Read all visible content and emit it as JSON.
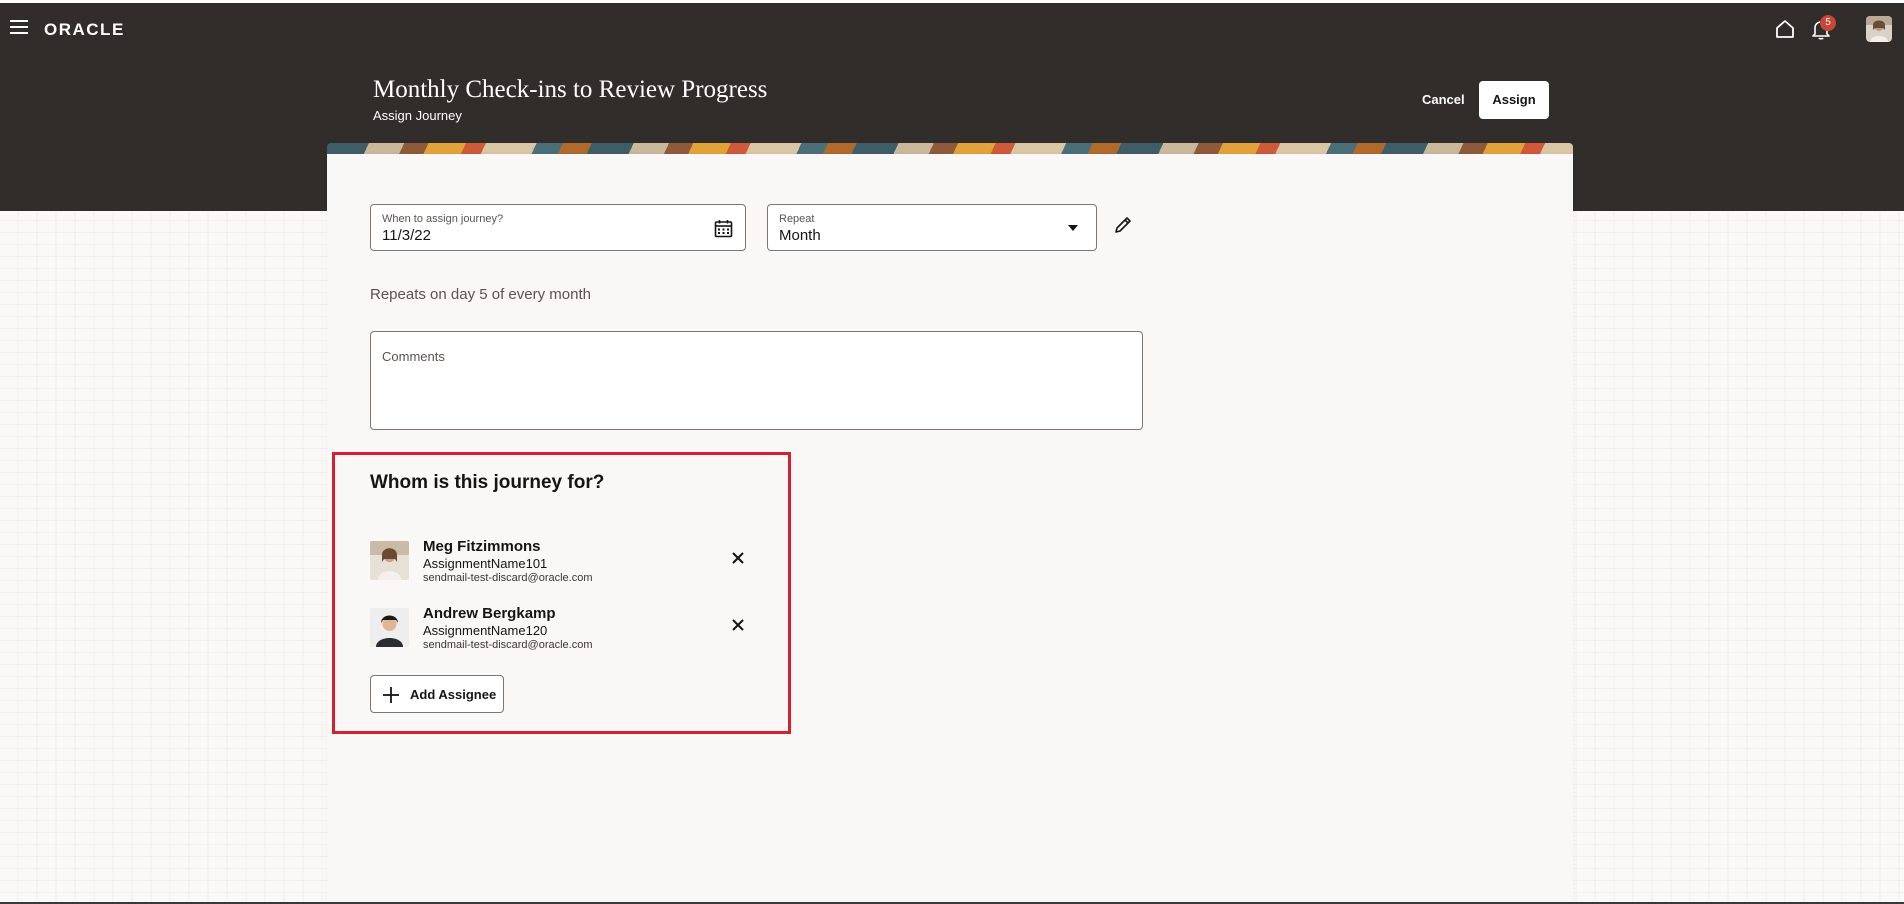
{
  "app": {
    "brand": "ORACLE",
    "notification_count": "5",
    "icons": {
      "menu": "hamburger-icon",
      "home": "home-icon",
      "notifications": "bell-icon",
      "user": "avatar"
    }
  },
  "header": {
    "title": "Monthly Check-ins to Review Progress",
    "subtitle": "Assign Journey",
    "cancel_label": "Cancel",
    "assign_label": "Assign"
  },
  "form": {
    "date": {
      "label": "When to assign journey?",
      "value": "11/3/22",
      "icon": "calendar-icon"
    },
    "repeat": {
      "label": "Repeat",
      "value": "Month",
      "icon": "chevron-down-icon"
    },
    "edit_icon": "pencil-icon",
    "repeat_info": "Repeats on day 5 of every month",
    "comments": {
      "label": "Comments",
      "value": ""
    }
  },
  "assignees": {
    "heading": "Whom is this journey for?",
    "items": [
      {
        "name": "Meg Fitzimmons",
        "assignment": "AssignmentName101",
        "email": "sendmail-test-discard@oracle.com"
      },
      {
        "name": "Andrew Bergkamp",
        "assignment": "AssignmentName120",
        "email": "sendmail-test-discard@oracle.com"
      }
    ],
    "add_label": "Add Assignee"
  },
  "colors": {
    "header_bg": "#312d2a",
    "highlight_border": "#d6202f",
    "badge": "#c74634"
  }
}
